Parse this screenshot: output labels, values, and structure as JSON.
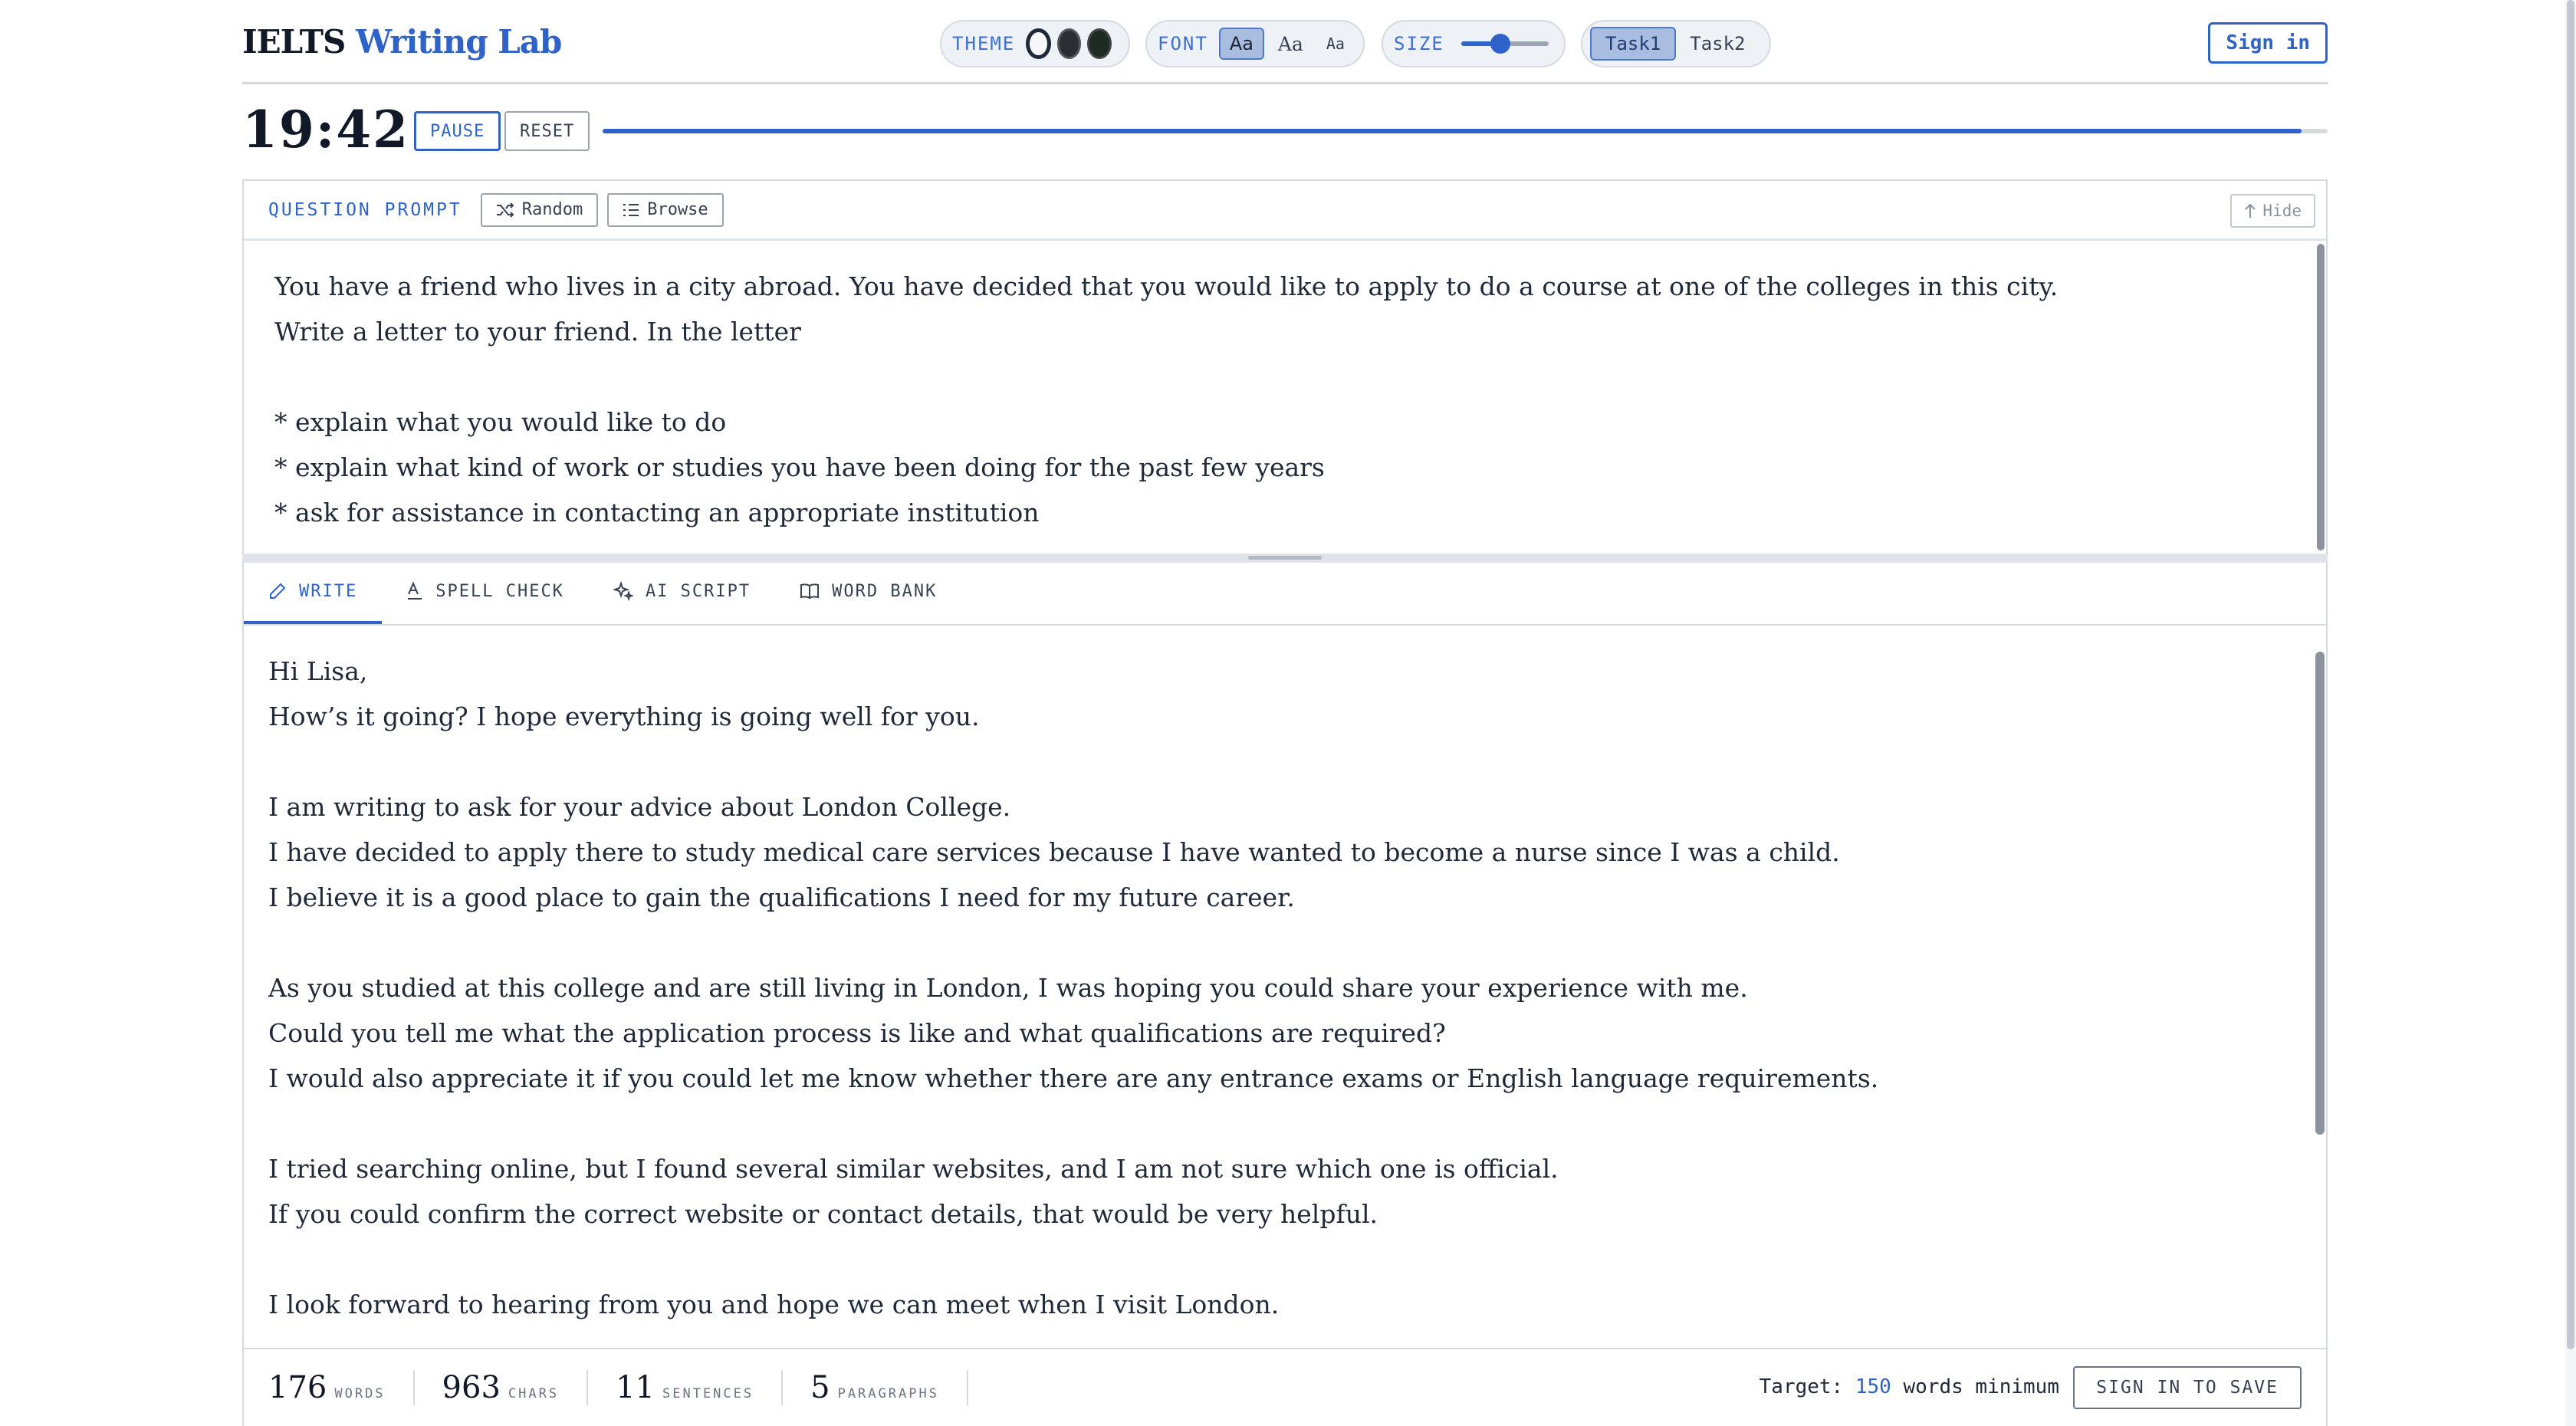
{
  "header": {
    "logo_main": "IELTS",
    "logo_accent": "Writing Lab",
    "theme_label": "THEME",
    "font_label": "FONT",
    "font_options": [
      "Aa",
      "Aa",
      "Aa"
    ],
    "size_label": "SIZE",
    "size_level": 0.45,
    "tasks": [
      "Task1",
      "Task2"
    ],
    "signin_label": "Sign in"
  },
  "colors": {
    "accent": "#2f63c9"
  },
  "timer": {
    "time": "19:42",
    "pause_label": "PAUSE",
    "reset_label": "RESET",
    "progress": 0.985
  },
  "prompt": {
    "label": "QUESTION PROMPT",
    "random_label": "Random",
    "browse_label": "Browse",
    "hide_label": "Hide",
    "text": "You have a friend who lives in a city abroad. You have decided that you would like to apply to do a course at one of the colleges in this city.\nWrite a letter to your friend. In the letter\n\n* explain what you would like to do\n* explain what kind of work or studies you have been doing for the past few years\n* ask for assistance in contacting an appropriate institution"
  },
  "tabs": {
    "write": "WRITE",
    "spell": "SPELL CHECK",
    "ai": "AI SCRIPT",
    "bank": "WORD BANK"
  },
  "essay": {
    "text": "Hi Lisa,\nHow’s it going? I hope everything is going well for you.\n\nI am writing to ask for your advice about London College.\nI have decided to apply there to study medical care services because I have wanted to become a nurse since I was a child.\nI believe it is a good place to gain the qualifications I need for my future career.\n\nAs you studied at this college and are still living in London, I was hoping you could share your experience with me.\nCould you tell me what the application process is like and what qualifications are required?\nI would also appreciate it if you could let me know whether there are any entrance exams or English language requirements.\n\nI tried searching online, but I found several similar websites, and I am not sure which one is official.\nIf you could confirm the correct website or contact details, that would be very helpful.\n\nI look forward to hearing from you and hope we can meet when I visit London."
  },
  "stats": {
    "words": "176",
    "words_label": "WORDS",
    "chars": "963",
    "chars_label": "CHARS",
    "sentences": "11",
    "sentences_label": "SENTENCES",
    "paragraphs": "5",
    "paragraphs_label": "PARAGRAPHS"
  },
  "target": {
    "prefix": "Target:",
    "value": "150",
    "suffix": "words minimum"
  },
  "save_label": "SIGN IN TO SAVE"
}
